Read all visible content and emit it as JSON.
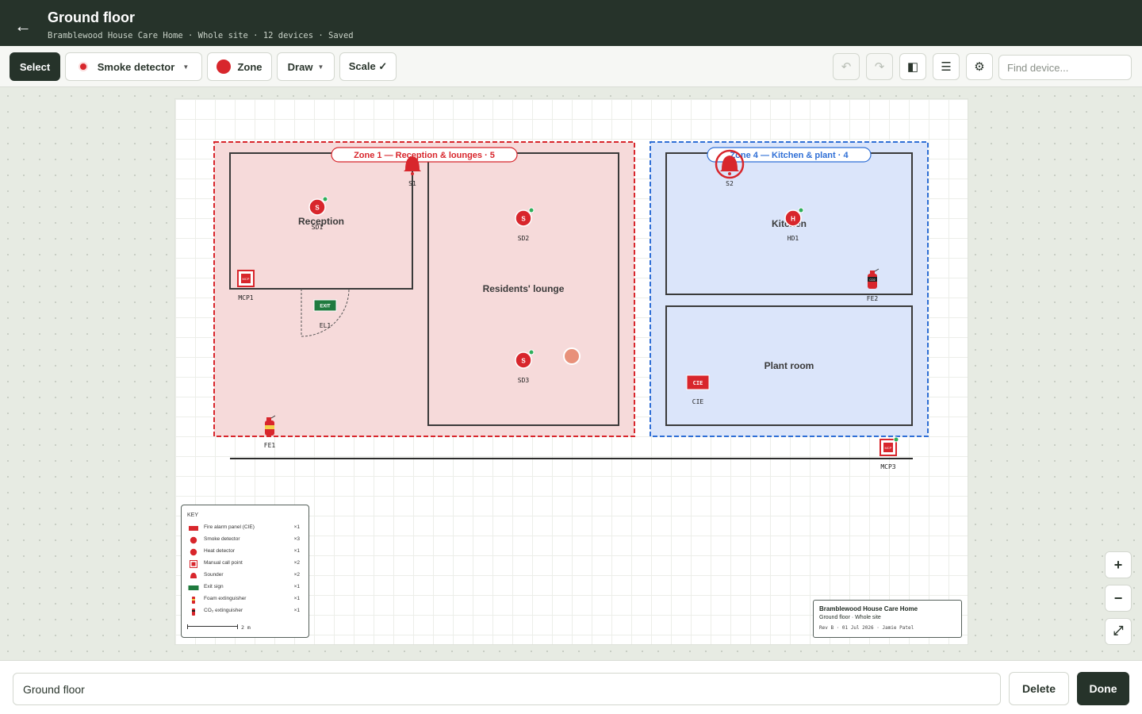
{
  "header": {
    "title": "Ground floor",
    "subtitle": "Bramblewood House Care Home · Whole site · 12 devices · Saved"
  },
  "toolbar": {
    "select_label": "Select",
    "device_type_label": "Smoke detector",
    "zone_label": "Zone",
    "draw_label": "Draw",
    "scale_label": "Scale ✓",
    "find_placeholder": "Find device...",
    "accent_color": "#d8262c"
  },
  "plan": {
    "zones": [
      {
        "label": "Zone 1 — Reception & lounges · 5",
        "color": "#d8262c"
      },
      {
        "label": "Zone 4 — Kitchen & plant · 4",
        "color": "#2f6fd6"
      }
    ],
    "rooms": {
      "reception": "Reception",
      "lounge": "Residents' lounge",
      "kitchen": "Kitchen",
      "plant": "Plant room"
    },
    "devices": {
      "sd1": {
        "id": "SD1",
        "glyph": "S"
      },
      "sd2": {
        "id": "SD2",
        "glyph": "S"
      },
      "sd3": {
        "id": "SD3",
        "glyph": "S"
      },
      "hd1": {
        "id": "HD1",
        "glyph": "H"
      },
      "s1": {
        "id": "S1"
      },
      "s2": {
        "id": "S2"
      },
      "mcp1": {
        "id": "MCP1",
        "glyph": "MCP"
      },
      "mcp3": {
        "id": "MCP3",
        "glyph": "MCP"
      },
      "el1": {
        "id": "EL1",
        "glyph": "EXIT"
      },
      "fe1": {
        "id": "FE1"
      },
      "fe2": {
        "id": "FE2",
        "glyph": "CO2"
      },
      "cie": {
        "id": "CIE",
        "glyph": "CIE"
      }
    }
  },
  "legend": {
    "title": "KEY",
    "items": [
      {
        "label": "Fire alarm panel (CIE)",
        "count": "×1",
        "icon": "panel-icon"
      },
      {
        "label": "Smoke detector",
        "count": "×3",
        "icon": "smoke-detector-icon"
      },
      {
        "label": "Heat detector",
        "count": "×1",
        "icon": "heat-detector-icon"
      },
      {
        "label": "Manual call point",
        "count": "×2",
        "icon": "call-point-icon"
      },
      {
        "label": "Sounder",
        "count": "×2",
        "icon": "sounder-icon"
      },
      {
        "label": "Exit sign",
        "count": "×1",
        "icon": "exit-sign-icon"
      },
      {
        "label": "Foam extinguisher",
        "count": "×1",
        "icon": "foam-extinguisher-icon"
      },
      {
        "label": "CO₂ extinguisher",
        "count": "×1",
        "icon": "co2-extinguisher-icon"
      }
    ],
    "scale_label": "2 m"
  },
  "titleblock": {
    "org": "Bramblewood House Care Home",
    "floor": "Ground floor · Whole site",
    "rev": "Rev B · 01 Jul 2026 · Jamie Patel"
  },
  "bottom": {
    "floor_name_value": "Ground floor",
    "delete_label": "Delete",
    "done_label": "Done"
  }
}
